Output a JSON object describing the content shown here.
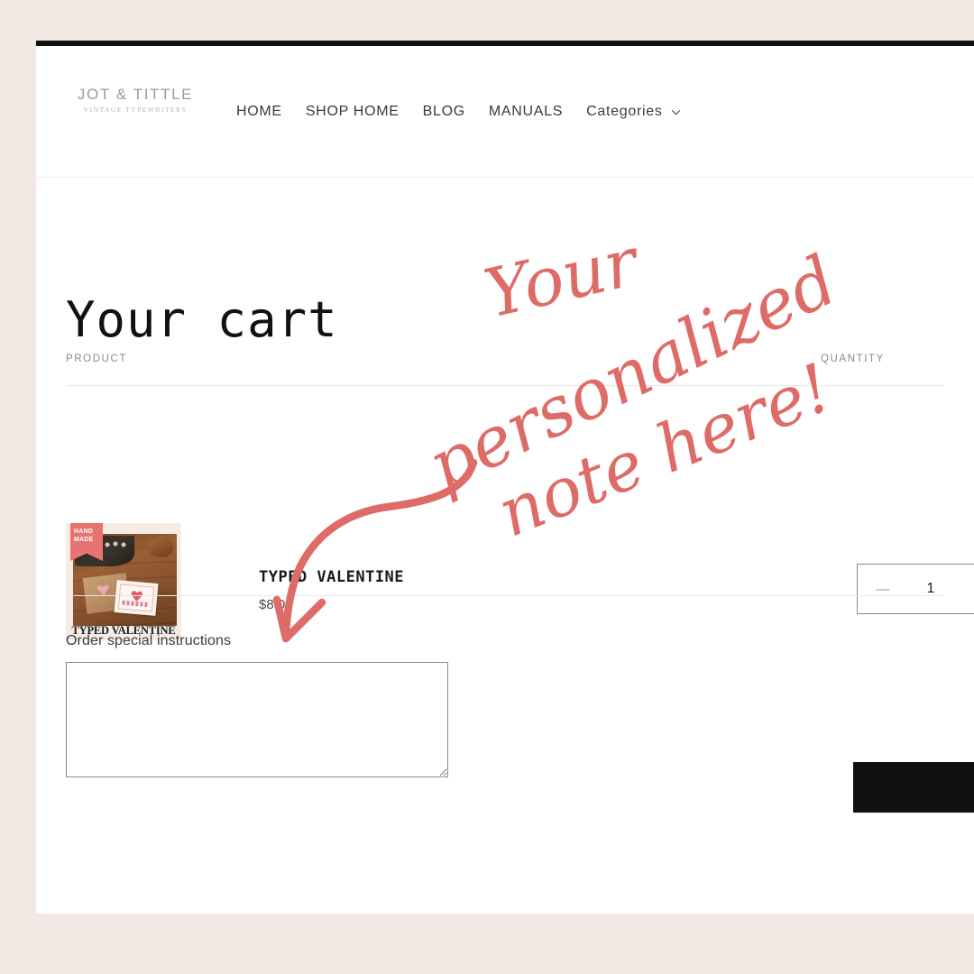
{
  "theme": {
    "page_background": "#f2e9e4",
    "panel_background": "#ffffff",
    "accent_bar": "#111111",
    "annotation_color": "#de6b68",
    "text_primary": "#1a1a1a",
    "text_muted": "#8a8a8a",
    "rule_color": "#ebe7e4"
  },
  "header": {
    "brand": {
      "name": "JOT & TITTLE",
      "tagline": "VINTAGE TYPEWRITERS"
    },
    "nav": [
      {
        "label": "HOME",
        "uppercase": true,
        "has_chevron": false
      },
      {
        "label": "SHOP HOME",
        "uppercase": true,
        "has_chevron": false
      },
      {
        "label": "BLOG",
        "uppercase": true,
        "has_chevron": false
      },
      {
        "label": "MANUALS",
        "uppercase": true,
        "has_chevron": false
      },
      {
        "label": "Categories",
        "uppercase": false,
        "has_chevron": true
      }
    ]
  },
  "cart": {
    "title": "Your cart",
    "columns": {
      "product": "PRODUCT",
      "quantity": "QUANTITY"
    },
    "items": [
      {
        "title": "TYPED VALENTINE",
        "price": "$8.00",
        "quantity": "1",
        "thumbnail": {
          "badge_line1": "HAND",
          "badge_line2": "MADE",
          "caption": "TYPED VALENTINE"
        }
      }
    ],
    "quantity_controls": {
      "decrease_label": "—"
    }
  },
  "instructions": {
    "label": "Order special instructions",
    "value": "",
    "placeholder": ""
  },
  "checkout": {
    "label": ""
  },
  "annotation": {
    "line1": "Your",
    "line2": "personalized",
    "line3": "note here!",
    "full_text": "Your personalized note here!"
  }
}
